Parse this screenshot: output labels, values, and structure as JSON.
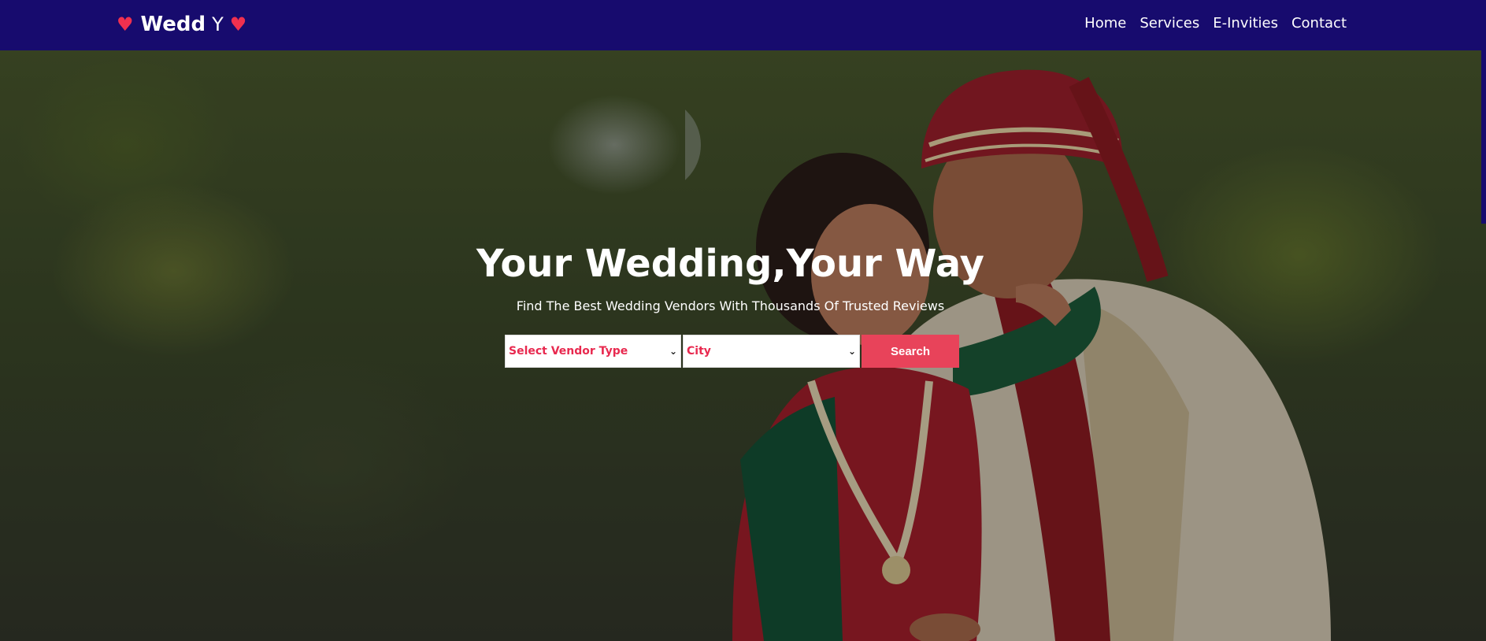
{
  "brand": {
    "name": "Wedd",
    "suffix": "Y",
    "heart_left": "♥",
    "heart_right": "♥",
    "heart_color": "#f0304f"
  },
  "nav": {
    "background": "#170b6e",
    "links": [
      "Home",
      "Services",
      "E-Invities",
      "Contact"
    ]
  },
  "hero": {
    "title": "Your Wedding,Your Way",
    "subtitle": "Find The Best Wedding Vendors With Thousands Of Trusted Reviews",
    "vendor_select": {
      "selected": "Select Vendor Type",
      "caret": "⌄"
    },
    "city_select": {
      "selected": "City",
      "caret": "⌄"
    },
    "search_label": "Search",
    "accent": "#e8435a",
    "background_image": "couple-photo"
  }
}
